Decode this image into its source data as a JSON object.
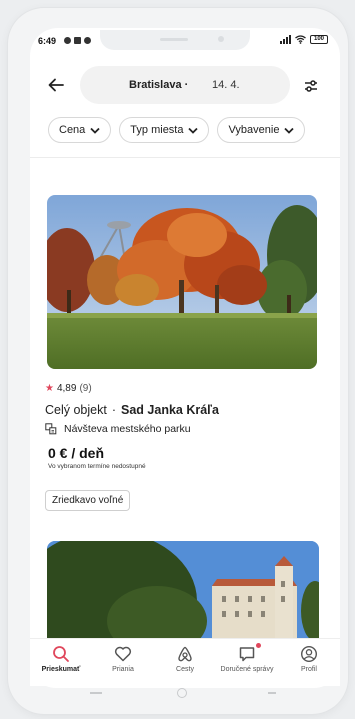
{
  "status_bar": {
    "time": "6:49",
    "battery": "100"
  },
  "header": {
    "location": "Bratislava",
    "separator": "·",
    "date": "14. 4."
  },
  "filters": [
    {
      "label": "Cena"
    },
    {
      "label": "Typ miesta"
    },
    {
      "label": "Vybavenie"
    }
  ],
  "listing": {
    "rating": "4,89",
    "reviews": "(9)",
    "type": "Celý objekt",
    "separator": "·",
    "name": "Sad Janka Kráľa",
    "activity": "Návšteva mestského parku",
    "price": "0 € / deň",
    "price_note": "Vo vybranom termíne nedostupné",
    "availability_badge": "Zriedkavo voľné"
  },
  "bottom_nav": [
    {
      "label": "Prieskumať",
      "icon": "search-icon",
      "active": true
    },
    {
      "label": "Priania",
      "icon": "heart-icon",
      "active": false
    },
    {
      "label": "Cesty",
      "icon": "airbnb-icon",
      "active": false
    },
    {
      "label": "Doručené správy",
      "icon": "message-icon",
      "active": false
    },
    {
      "label": "Profil",
      "icon": "profile-icon",
      "active": false
    }
  ],
  "colors": {
    "accent": "#e0475c",
    "text": "#222222"
  }
}
